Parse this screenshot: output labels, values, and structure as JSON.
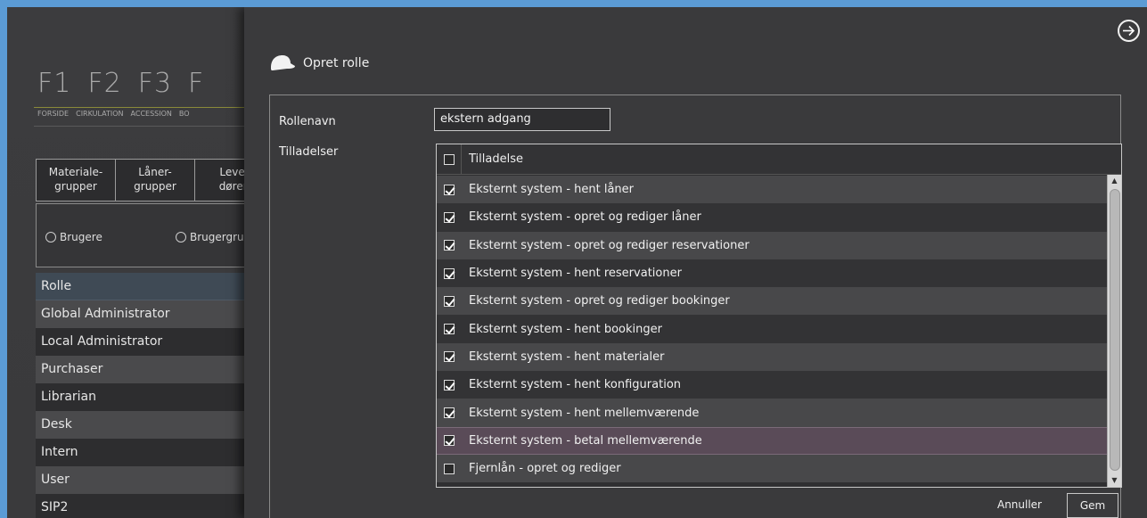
{
  "background_app": {
    "fkeys": [
      "F1",
      "F2",
      "F3",
      "F"
    ],
    "fkey_labels": [
      "FORSIDE",
      "CIRKULATION",
      "ACCESSION",
      "BO"
    ],
    "tabs": [
      "Materiale-\ngrupper",
      "Låner-\ngrupper",
      "Lever\ndøren"
    ],
    "radios": [
      "Brugere",
      "Brugergru"
    ],
    "role_header": "Rolle",
    "roles": [
      "Global Administrator",
      "Local Administrator",
      "Purchaser",
      "Librarian",
      "Desk",
      "Intern",
      "User",
      "SIP2"
    ]
  },
  "dialog": {
    "title": "Opret rolle",
    "close_icon": "arrow-right-circle-icon",
    "role_name_label": "Rollenavn",
    "role_name_value": "ekstern adgang",
    "permissions_label": "Tilladelser",
    "table_header": "Tilladelse",
    "permissions": [
      {
        "label": "Eksternt system - hent låner",
        "checked": true
      },
      {
        "label": "Eksternt system - opret og rediger låner",
        "checked": true
      },
      {
        "label": "Eksternt system - opret og rediger reservationer",
        "checked": true
      },
      {
        "label": "Eksternt system - hent reservationer",
        "checked": true
      },
      {
        "label": "Eksternt system - opret og rediger bookinger",
        "checked": true
      },
      {
        "label": "Eksternt system - hent bookinger",
        "checked": true
      },
      {
        "label": "Eksternt system - hent materialer",
        "checked": true
      },
      {
        "label": "Eksternt system - hent konfiguration",
        "checked": true
      },
      {
        "label": "Eksternt system - hent mellemværende",
        "checked": true
      },
      {
        "label": "Eksternt system - betal mellemværende",
        "checked": true,
        "selected": true
      },
      {
        "label": "Fjernlån - opret og rediger",
        "checked": false
      }
    ],
    "cancel_label": "Annuller",
    "save_label": "Gem"
  }
}
